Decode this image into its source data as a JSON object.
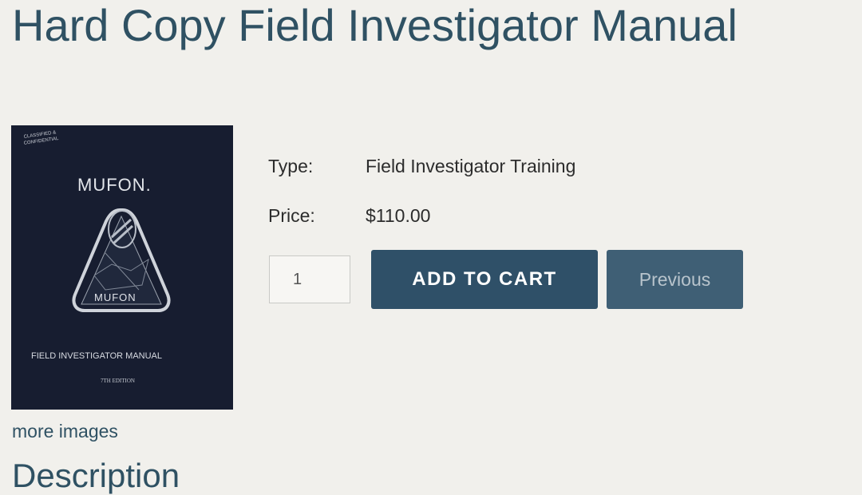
{
  "page": {
    "title": "Hard Copy Field Investigator Manual"
  },
  "product_image": {
    "cover_text": {
      "classification": [
        "CLASSIFIED &",
        "CONFIDENTIAL"
      ],
      "brand": "MUFON.",
      "emblem_brand": "MUFON",
      "manual_title": "FIELD INVESTIGATOR MANUAL",
      "edition": "7TH EDITION"
    },
    "colors": {
      "cover": "#141a2b",
      "cover_text": "#d8dbe2"
    }
  },
  "gallery": {
    "more_images_label": "more images"
  },
  "details": {
    "type_label": "Type:",
    "type_value": "Field Investigator Training",
    "price_label": "Price:",
    "price_value": "$110.00"
  },
  "cart": {
    "quantity_value": "1",
    "add_to_cart_label": "ADD TO CART",
    "previous_label": "Previous"
  },
  "description": {
    "heading": "Description"
  },
  "colors": {
    "accent": "#2f5163",
    "button": "#2f5068",
    "background": "#f1f0ec"
  }
}
